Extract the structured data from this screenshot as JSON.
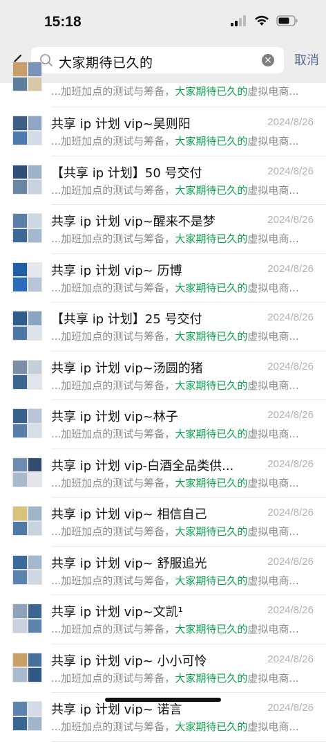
{
  "status": {
    "time": "15:18"
  },
  "search": {
    "query": "大家期待已久的",
    "cancel": "取消",
    "clear": "×"
  },
  "snippet": {
    "pre": "...加班加点的测试与筹备，",
    "hl": "大家期待已久的",
    "post": "虚拟电商..."
  },
  "partial_top": {
    "snippet_pre": "...加班加点的测试与筹备，",
    "snippet_hl": "大家期待已久的",
    "snippet_post": "虚拟电商..."
  },
  "results": [
    {
      "title": "共享 ip 计划 vip~吴则阳",
      "date": "2024/8/26"
    },
    {
      "title": "【共享 ip 计划】50 号交付",
      "date": "2024/8/26"
    },
    {
      "title": "共享 ip 计划 vip~醒来不是梦",
      "date": "2024/8/26"
    },
    {
      "title": "共享 ip 计划 vip~ 历博",
      "date": "2024/8/26"
    },
    {
      "title": "【共享 ip 计划】25 号交付",
      "date": "2024/8/26"
    },
    {
      "title": "共享 ip 计划 vip~汤圆的猪",
      "date": "2024/8/26"
    },
    {
      "title": "共享 ip 计划 vip~林子",
      "date": "2024/8/26"
    },
    {
      "title": "共享 ip 计划 vip-白酒全品类供...",
      "date": "2024/8/26"
    },
    {
      "title": "共享 ip 计划 vip~ 相信自己",
      "date": "2024/8/26"
    },
    {
      "title": "共享 ip 计划 vip~ 舒服追光",
      "date": "2024/8/26"
    },
    {
      "title": "共享 ip 计划 vip~文凯¹",
      "date": "2024/8/26"
    },
    {
      "title": "共享 ip 计划 vip~ 小小可怜",
      "date": "2024/8/26"
    },
    {
      "title": "共享 ip 计划 vip~ 诺言",
      "date": "2024/8/26"
    }
  ]
}
